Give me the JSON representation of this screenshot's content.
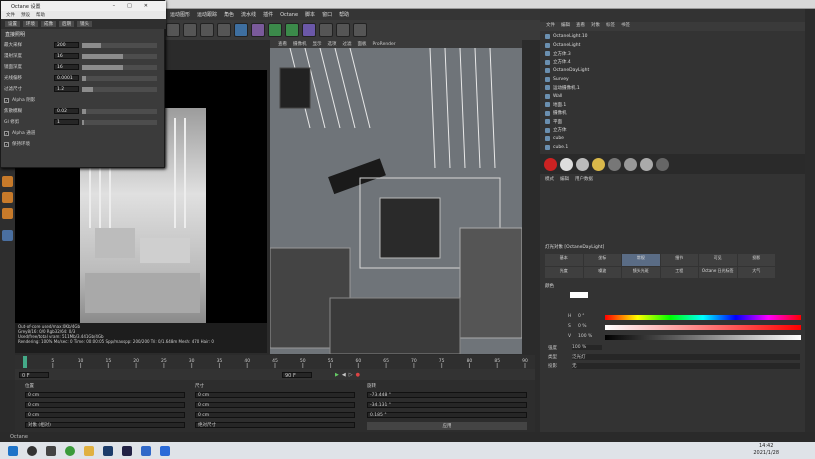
{
  "app": {
    "window_title": "Octane 设置",
    "status_text": "Octane"
  },
  "dialog": {
    "menu": [
      "文件",
      "预设",
      "帮助"
    ],
    "tabs": [
      "设置",
      "环境",
      "成像",
      "后期",
      "镜头"
    ],
    "section": "直接照明",
    "rows": [
      {
        "label": "最大采样",
        "value": "200",
        "fill": 0.25
      },
      {
        "label": "漫射深度",
        "value": "16",
        "fill": 0.55
      },
      {
        "label": "镜面深度",
        "value": "16",
        "fill": 0.55
      },
      {
        "label": "光线偏移",
        "value": "0.0001",
        "fill": 0.05
      },
      {
        "label": "过滤尺寸",
        "value": "1.2",
        "fill": 0.15
      },
      {
        "label": "Alpha 阴影",
        "checkbox": true
      },
      {
        "label": "焦散模糊",
        "value": "0.02",
        "fill": 0.05
      },
      {
        "label": "GI 修剪",
        "value": "1",
        "fill": 0.02
      },
      {
        "label": "Alpha 通道",
        "checkbox": true
      },
      {
        "label": "保持环境",
        "checkbox": true
      }
    ]
  },
  "menubar": [
    "运动图形",
    "运动跟踪",
    "角色",
    "流水线",
    "插件",
    "Octane",
    "脚本",
    "窗口",
    "帮助"
  ],
  "viewport": {
    "tabs": [
      "查看",
      "摄像机",
      "显示",
      "选项",
      "过滤",
      "面板",
      "ProRender"
    ]
  },
  "render": {
    "stats": [
      "Out-of-core used/max:0Kb/4Gb",
      "Grey8/16: 0/0      Rgb32/64: 0/3",
      "Used/free/total vram: 511Mb/3.441Gb/4Gb",
      "Rendering: 100%  Ms/sec: 0  Time: 00:00:05  Spp/maxspp: 200/200  Tri: 0/1.648m  Mesh: 470  Hair: 0"
    ]
  },
  "object_manager": {
    "tabs": [
      "文件",
      "编辑",
      "查看",
      "对象",
      "标签",
      "书签"
    ],
    "items": [
      "OctaneLight.10",
      "OctaneLight",
      "立方体.3",
      "立方体.4",
      "OctaneDayLight",
      "Survey",
      "运动摄像机.1",
      "Wall",
      "地面.1",
      "摄像机",
      "平面",
      "立方体",
      "cube",
      "cube.1"
    ]
  },
  "attributes": {
    "tabs": [
      "模式",
      "编辑",
      "用户数据"
    ],
    "object_label": "灯光对象 [OctaneDayLight]",
    "grid": [
      "基本",
      "坐标",
      "常规",
      "细节",
      "可见",
      "投影",
      "光度",
      "噪波",
      "镜头光斑",
      "工程",
      "Octane 日光标签",
      "大气"
    ],
    "selected_tab": "常规",
    "color_label": "颜色",
    "h_label": "H",
    "h_value": "0 °",
    "s_label": "S",
    "s_value": "0 %",
    "v_label": "V",
    "v_value": "100 %",
    "intensity_label": "强度",
    "intensity_value": "100 %",
    "type_label": "类型",
    "type_value": "泛光灯",
    "shadow_label": "投影",
    "shadow_value": "无"
  },
  "timeline": {
    "ticks": [
      "0",
      "5",
      "10",
      "15",
      "20",
      "25",
      "30",
      "35",
      "40",
      "45",
      "50",
      "55",
      "60",
      "65",
      "70",
      "75",
      "80",
      "85",
      "90"
    ],
    "start": "0 F",
    "end": "90 F",
    "current": "0 F"
  },
  "coords": {
    "headers": [
      "位置",
      "尺寸",
      "旋转"
    ],
    "x": {
      "pos": "0 cm",
      "size": "0 cm",
      "rot": "-73.448 °"
    },
    "y": {
      "pos": "0 cm",
      "size": "0 cm",
      "rot": "-34.131 °"
    },
    "z": {
      "pos": "0 cm",
      "size": "0 cm",
      "rot": "0.185 °"
    },
    "mode": "对象 (相对)",
    "size_mode": "绝对尺寸",
    "apply": "应用"
  },
  "taskbar": {
    "time": "14:42",
    "date": "2021/1/28"
  },
  "colors": {
    "accent": "#5a6c85",
    "icon_orange": "#c77a2a"
  }
}
